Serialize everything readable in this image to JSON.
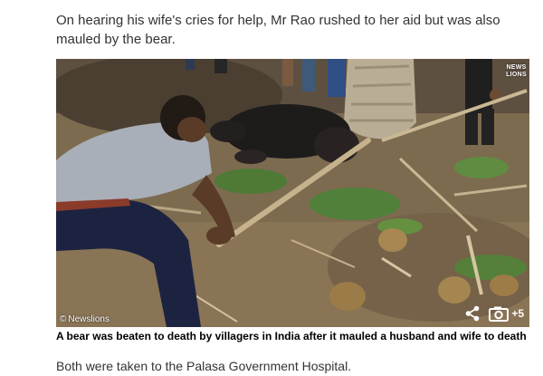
{
  "article": {
    "paragraph_top": "On hearing his wife's cries for help, Mr Rao rushed to her aid but was also mauled by the bear.",
    "paragraph_bottom": "Both were taken to the Palasa Government Hospital."
  },
  "image": {
    "credit": "Newslions",
    "brand_line1": "NEWS",
    "brand_line2": "LIONS",
    "gallery_count": "+5",
    "caption": "A bear was beaten to death by villagers in India after it mauled a husband and wife to death"
  },
  "icons": {
    "share": "share-icon",
    "camera": "camera-icon",
    "copyright": "copyright-icon"
  },
  "colors": {
    "text": "#333333",
    "caption": "#000000",
    "overlay_text": "#ffffff"
  }
}
